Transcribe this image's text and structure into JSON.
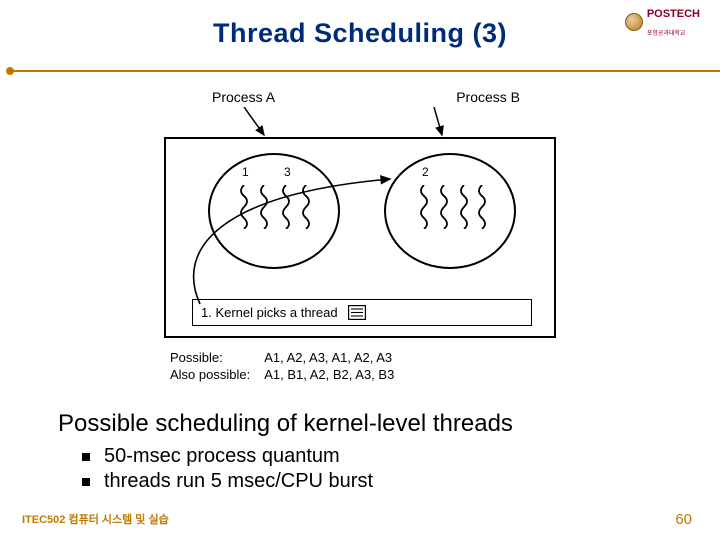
{
  "header": {
    "title": "Thread Scheduling (3)",
    "logo_text": "POSTECH",
    "logo_sub": "포항공과대학교"
  },
  "diagram": {
    "process_a_label": "Process A",
    "process_b_label": "Process B",
    "thread_ids_a": [
      "1",
      "3"
    ],
    "thread_ids_b": [
      "2"
    ],
    "caption": "1. Kernel picks a thread",
    "possible_label": "Possible:",
    "possible_seq": "A1, A2, A3, A1, A2, A3",
    "also_label": "Also possible:",
    "also_seq": "A1, B1, A2, B2, A3, B3"
  },
  "body": {
    "heading": "Possible scheduling of kernel-level threads",
    "bullet1": "50-msec process quantum",
    "bullet2": "threads run 5 msec/CPU burst"
  },
  "footer": {
    "left": "ITEC502 컴퓨터 시스템 및 실습",
    "page": "60"
  }
}
